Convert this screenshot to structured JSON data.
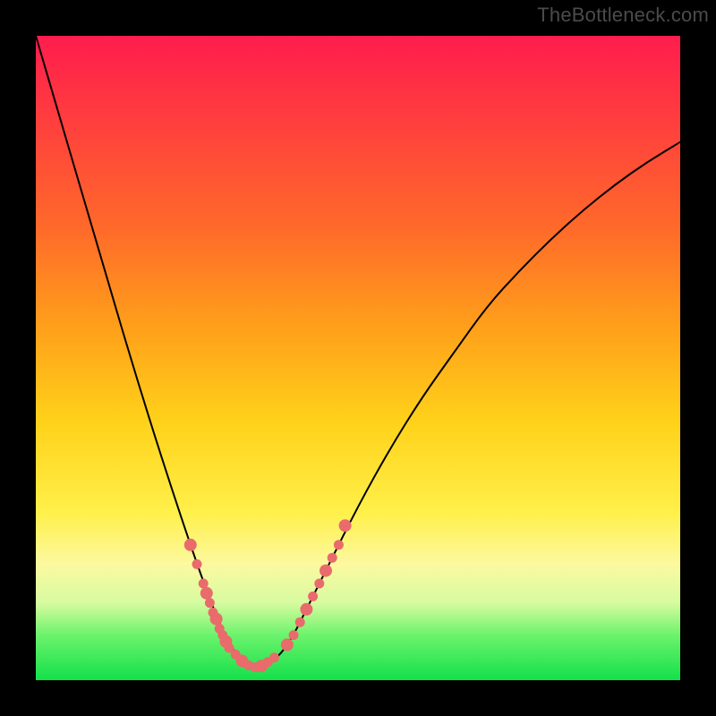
{
  "watermark": "TheBottleneck.com",
  "colors": {
    "background_black": "#000000",
    "gradient_top": "#ff1c4e",
    "gradient_mid1": "#ff9f1a",
    "gradient_mid2": "#fff04a",
    "gradient_bottom": "#13e04a",
    "curve": "#000000",
    "marker": "#e96b6b"
  },
  "chart_data": {
    "type": "line",
    "title": "",
    "xlabel": "",
    "ylabel": "",
    "xlim": [
      0,
      100
    ],
    "ylim": [
      0,
      100
    ],
    "grid": false,
    "legend": false,
    "description": "Bottleneck-style V-curve over rainbow gradient; minimum (best match) near x≈34.",
    "x": [
      0,
      5,
      10,
      15,
      20,
      25,
      28,
      30,
      32,
      34,
      36,
      38,
      40,
      42,
      45,
      50,
      55,
      60,
      65,
      70,
      75,
      80,
      85,
      90,
      95,
      100
    ],
    "y": [
      100,
      83,
      66,
      49,
      33,
      18,
      10,
      5.5,
      3,
      2,
      2.5,
      4,
      7,
      11,
      17,
      27,
      36,
      44,
      51,
      58,
      63.5,
      68.5,
      73,
      77,
      80.5,
      83.5
    ],
    "series": [
      {
        "name": "bottleneck-curve",
        "x": [
          0,
          5,
          10,
          15,
          20,
          25,
          28,
          30,
          32,
          34,
          36,
          38,
          40,
          42,
          45,
          50,
          55,
          60,
          65,
          70,
          75,
          80,
          85,
          90,
          95,
          100
        ],
        "y": [
          100,
          83,
          66,
          49,
          33,
          18,
          10,
          5.5,
          3,
          2,
          2.5,
          4,
          7,
          11,
          17,
          27,
          36,
          44,
          51,
          58,
          63.5,
          68.5,
          73,
          77,
          80.5,
          83.5
        ]
      },
      {
        "name": "highlighted-markers-left",
        "x": [
          24,
          25,
          26,
          26.5,
          27,
          27.5,
          28,
          28.5,
          29,
          29.5,
          30,
          31
        ],
        "y": [
          21,
          18,
          15,
          13.5,
          12,
          10.5,
          9.5,
          8,
          7,
          6,
          5,
          4
        ],
        "style": "dots"
      },
      {
        "name": "highlighted-markers-bottom",
        "x": [
          32,
          33,
          34,
          35,
          36,
          37
        ],
        "y": [
          3,
          2.3,
          2,
          2.2,
          2.8,
          3.5
        ],
        "style": "dots"
      },
      {
        "name": "highlighted-markers-right",
        "x": [
          39,
          40,
          41,
          42,
          43,
          44,
          45,
          46,
          47,
          48
        ],
        "y": [
          5.5,
          7,
          9,
          11,
          13,
          15,
          17,
          19,
          21,
          24
        ],
        "style": "dots"
      }
    ],
    "minimum": {
      "x": 34,
      "y": 2
    }
  }
}
